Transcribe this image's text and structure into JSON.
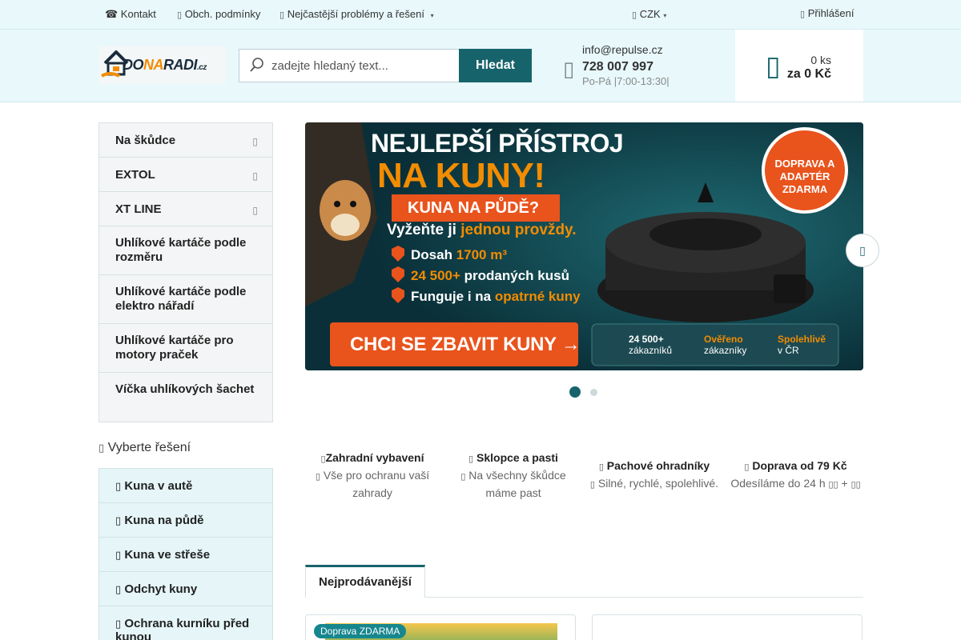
{
  "topbar": {
    "contact": "☎ Kontakt",
    "terms": "Obch. podmínky",
    "faq": "Nejčastější problémy a řešení",
    "currency": "CZK",
    "login": "Přihlášení"
  },
  "header": {
    "logo": {
      "part1": "DO",
      "part2": "NA",
      "part3": "RADI",
      "part4": ".cz"
    },
    "search_placeholder": "zadejte hledaný text...",
    "search_button": "Hledat",
    "email": "info@repulse.cz",
    "phone": "728 007 997",
    "hours": "Po-Pá |7:00-13:30|",
    "cart_count": "0 ks",
    "cart_total": "za 0 Kč"
  },
  "sidebar": {
    "items": [
      {
        "label": "Na škůdce",
        "submenu": true
      },
      {
        "label": "EXTOL",
        "submenu": true
      },
      {
        "label": "XT LINE",
        "submenu": true
      },
      {
        "label": "Uhlíkové kartáče podle rozměru"
      },
      {
        "label": "Uhlíkové kartáče podle elektro nářadí"
      },
      {
        "label": "Uhlíkové kartáče pro motory praček"
      },
      {
        "label": "Víčka uhlíkových šachet"
      }
    ],
    "solutions_title": "Vyberte řešení",
    "solutions": [
      "Kuna v autě",
      "Kuna na půdě",
      "Kuna ve střeše",
      "Odchyt kuny",
      "Ochrana kurníku před kunou"
    ]
  },
  "banner": {
    "headline1": "NEJLEPŠÍ PŘÍSTROJ",
    "headline2": "NA KUNY!",
    "ribbon": "KUNA NA PŮDĚ?",
    "subline_a": "Vyžeňte ji ",
    "subline_b": "jednou provždy.",
    "bullet1_a": "Dosah ",
    "bullet1_b": "1700 m³",
    "bullet2_a": "24 500+ ",
    "bullet2_b": "prodaných kusů",
    "bullet3_a": "Funguje i na ",
    "bullet3_b": "opatrné kuny",
    "cta": "CHCI SE ZBAVIT KUNY →",
    "badge1": "DOPRAVA A",
    "badge2": "ADAPTÉR",
    "badge3": "ZDARMA",
    "trust1_a": "24 500+",
    "trust1_b": "zákazníků",
    "trust2_a": "Ověřeno",
    "trust2_b": "zákazníky",
    "trust3_a": "Spolehlivě",
    "trust3_b": "v ČR"
  },
  "features": [
    {
      "title": "Zahradní vybavení",
      "desc": "Vše pro ochranu vaší zahrady"
    },
    {
      "title": "Sklopce a pasti",
      "desc": "Na všechny škůdce máme past"
    },
    {
      "title": "Pachové ohradníky",
      "desc": "Silné, rychlé, spolehlivé."
    },
    {
      "title": "Doprava od 79 Kč",
      "desc": "Odesíláme do 24 h"
    }
  ],
  "tabs": {
    "bestsellers": "Nejprodávanější"
  },
  "products": {
    "badge": "Doprava ZDARMA"
  },
  "colors": {
    "accent": "#17636b",
    "orange": "#f28c00",
    "topbar_bg": "#e8f8fb"
  }
}
